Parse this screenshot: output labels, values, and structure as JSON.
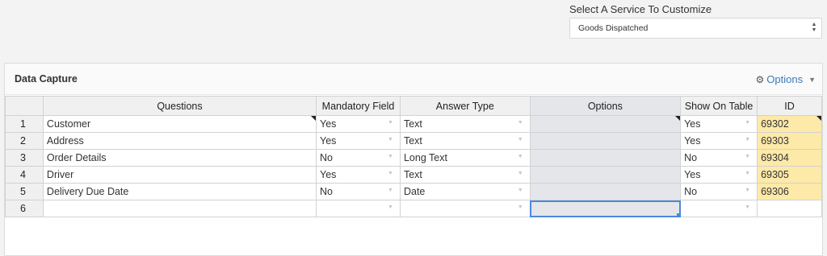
{
  "service": {
    "label": "Select A Service To Customize",
    "selected": "Goods Dispatched"
  },
  "panel": {
    "title": "Data Capture",
    "options_label": "Options"
  },
  "columns": [
    "",
    "Questions",
    "Mandatory Field",
    "Answer Type",
    "Options",
    "Show On Table",
    "ID"
  ],
  "rows": [
    {
      "num": "1",
      "question": "Customer",
      "mandatory": "Yes",
      "answer_type": "Text",
      "options": "",
      "show": "Yes",
      "id": "69302"
    },
    {
      "num": "2",
      "question": "Address",
      "mandatory": "Yes",
      "answer_type": "Text",
      "options": "",
      "show": "Yes",
      "id": "69303"
    },
    {
      "num": "3",
      "question": "Order Details",
      "mandatory": "No",
      "answer_type": "Long Text",
      "options": "",
      "show": "No",
      "id": "69304"
    },
    {
      "num": "4",
      "question": "Driver",
      "mandatory": "Yes",
      "answer_type": "Text",
      "options": "",
      "show": "Yes",
      "id": "69305"
    },
    {
      "num": "5",
      "question": "Delivery Due Date",
      "mandatory": "No",
      "answer_type": "Date",
      "options": "",
      "show": "No",
      "id": "69306"
    },
    {
      "num": "6",
      "question": "",
      "mandatory": "",
      "answer_type": "",
      "options": "",
      "show": "",
      "id": ""
    }
  ],
  "icons": {
    "gear": "gear-icon",
    "caret": "caret-down-icon",
    "select_arrows": "up-down-arrows-icon",
    "dropdown": "dropdown-arrow-icon"
  }
}
